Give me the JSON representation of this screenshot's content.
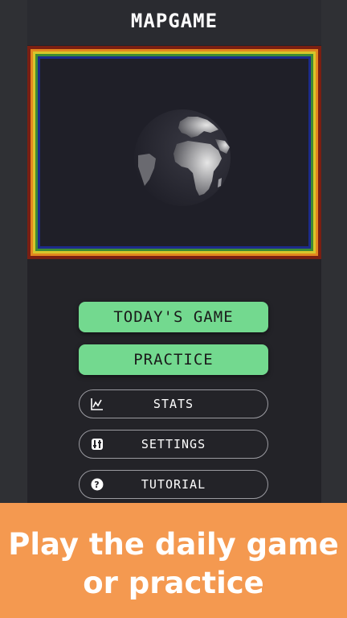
{
  "header": {
    "title": "MAPGAME"
  },
  "menu": {
    "todays_game": "TODAY'S GAME",
    "practice": "PRACTICE",
    "stats": "STATS",
    "settings": "SETTINGS",
    "tutorial": "TUTORIAL"
  },
  "icons": {
    "stats": "chart-icon",
    "settings": "settings-icon",
    "tutorial": "help-icon",
    "map": "globe-icon"
  },
  "banner": {
    "line1": "Play the daily game",
    "line2": "or practice"
  },
  "colors": {
    "primary_button": "#73d98f",
    "banner": "#f49950",
    "frame_outer": "#7a1f12",
    "frame_orange": "#e3871f",
    "frame_yellow": "#d6c62b",
    "frame_green": "#3e8c32",
    "frame_blue": "#1c2b8a"
  }
}
